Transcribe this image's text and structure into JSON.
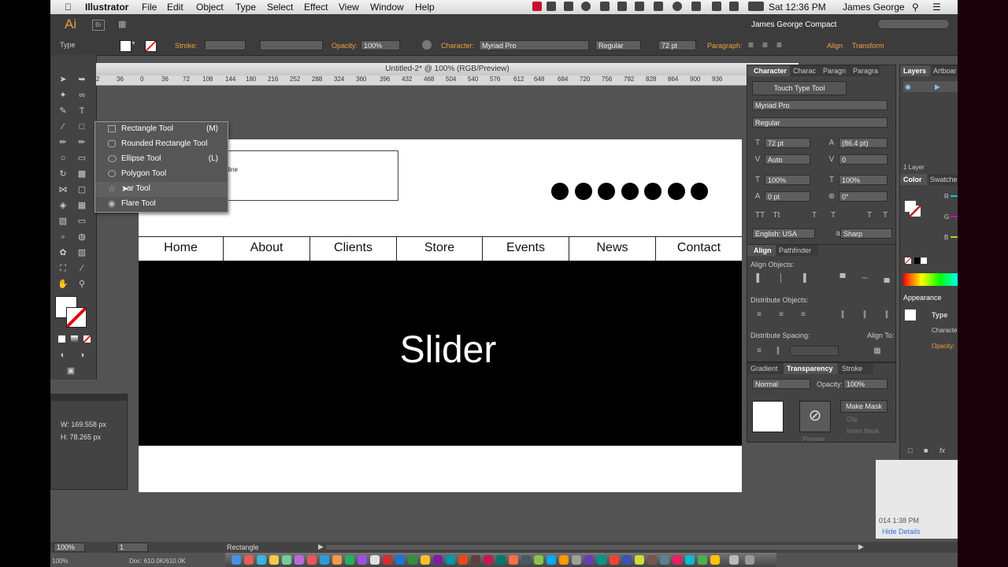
{
  "menubar": {
    "app": "Illustrator",
    "menus": [
      "File",
      "Edit",
      "Object",
      "Type",
      "Select",
      "Effect",
      "View",
      "Window",
      "Help"
    ],
    "clock": "Sat 12:36 PM",
    "user": "James George"
  },
  "control": {
    "ai_logo": "Ai",
    "br": "Br",
    "type_label": "Type",
    "stroke_label": "Stroke:",
    "opacity_label": "Opacity:",
    "opacity_value": "100%",
    "character_label": "Character:",
    "font": "Myriad Pro",
    "style": "Regular",
    "size": "72 pt",
    "paragraph_label": "Paragraph:",
    "align_label": "Align",
    "transform_label": "Transform",
    "workspace": "James George Compact"
  },
  "document": {
    "title": "Untitled-2* @ 100% (RGB/Preview)",
    "ruler": [
      "2",
      "36",
      "0",
      "36",
      "72",
      "108",
      "144",
      "180",
      "216",
      "252",
      "288",
      "324",
      "360",
      "396",
      "432",
      "468",
      "504",
      "540",
      "576",
      "612",
      "648",
      "684",
      "720",
      "756",
      "792",
      "828",
      "864",
      "900",
      "936"
    ]
  },
  "artboard": {
    "tagline": "gline",
    "nav": [
      "Home",
      "About",
      "Clients",
      "Store",
      "Events",
      "News",
      "Contact"
    ],
    "slider": "Slider",
    "dots": 7
  },
  "flyout": {
    "items": [
      {
        "label": "Rectangle Tool",
        "shortcut": "(M)"
      },
      {
        "label": "Rounded Rectangle Tool",
        "shortcut": ""
      },
      {
        "label": "Ellipse Tool",
        "shortcut": "(L)"
      },
      {
        "label": "Polygon Tool",
        "shortcut": ""
      },
      {
        "label": "ar Tool",
        "shortcut": ""
      },
      {
        "label": "Flare Tool",
        "shortcut": ""
      }
    ]
  },
  "transform": {
    "w": "W: 169.558 px",
    "h": "H: 78.265 px"
  },
  "character_panel": {
    "tabs": [
      "Character",
      "Charac",
      "Paragn",
      "Paragra"
    ],
    "touch_type": "Touch Type Tool",
    "font": "Myriad Pro",
    "style": "Regular",
    "size": "72 pt",
    "leading": "(86.4 pt)",
    "kerning": "Auto",
    "tracking": "0",
    "vscale": "100%",
    "hscale": "100%",
    "baseline": "0 pt",
    "rotation": "0°",
    "language": "English: USA",
    "aa": "Sharp"
  },
  "align_panel": {
    "tabs": [
      "Align",
      "Pathfinder"
    ],
    "align_objects": "Align Objects:",
    "distribute_objects": "Distribute Objects:",
    "distribute_spacing": "Distribute Spacing:",
    "align_to": "Align To:"
  },
  "transparency_panel": {
    "tabs": [
      "Gradient",
      "Transparency",
      "Stroke"
    ],
    "mode": "Normal",
    "opacity_label": "Opacity:",
    "opacity": "100%",
    "make_mask": "Make Mask",
    "clip": "Clip",
    "invert": "Invert Mask",
    "preview": "Preview"
  },
  "layers_panel": {
    "tabs": [
      "Layers",
      "Artboar"
    ],
    "count": "1 Layer"
  },
  "color_panel": {
    "tabs": [
      "Color",
      "Swatche"
    ],
    "r": "R",
    "g": "G",
    "b": "B"
  },
  "appearance_panel": {
    "title": "Appearance",
    "type": "Type",
    "character": "Characte",
    "opacity": "Opacity:"
  },
  "status": {
    "zoom": "100%",
    "artboard_num": "1",
    "tool": "Rectangle",
    "doc": "Doc: 610.0K/610.0K",
    "small_zoom": "100%"
  },
  "notification": {
    "time": "014  1:38 PM",
    "link": "Hide Details"
  }
}
